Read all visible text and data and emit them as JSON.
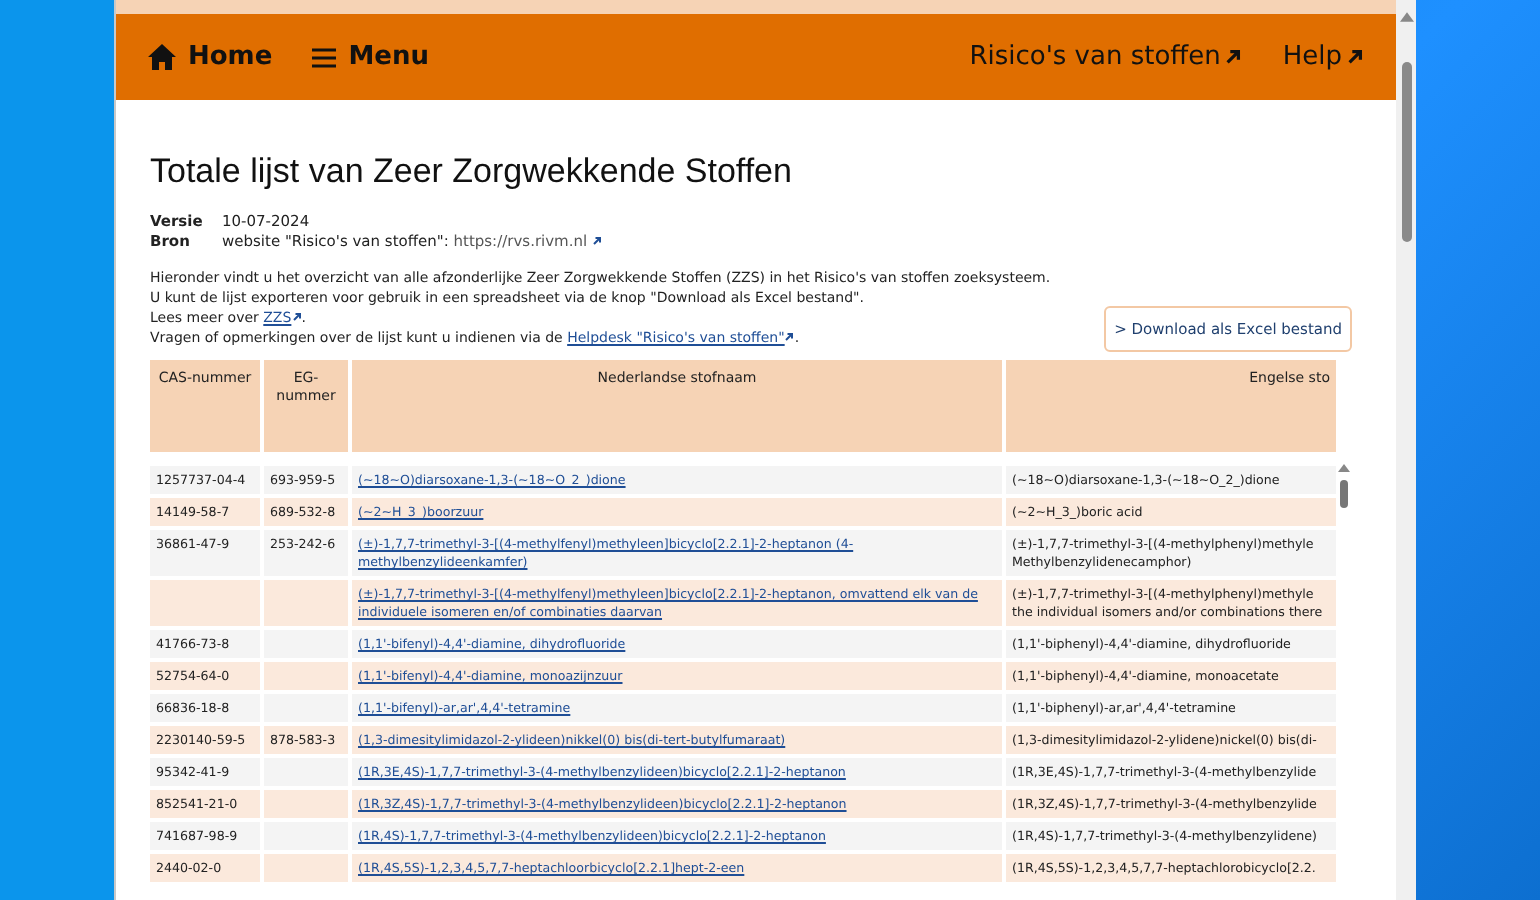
{
  "nav": {
    "home": "Home",
    "menu": "Menu",
    "links": [
      "Risico's van stoffen",
      "Help"
    ]
  },
  "page": {
    "title": "Totale lijst van Zeer Zorgwekkende Stoffen",
    "meta": [
      {
        "label": "Versie",
        "value": "10-07-2024"
      },
      {
        "label": "Bron",
        "value": "website \"Risico's van stoffen\": ",
        "link": "https://rvs.rivm.nl"
      }
    ],
    "intro": [
      "Hieronder vindt u het overzicht van alle afzonderlijke Zeer Zorgwekkende Stoffen (ZZS) in het Risico's van stoffen zoeksysteem.",
      "U kunt de lijst exporteren voor gebruik in een spreadsheet via de knop \"Download als Excel bestand\"."
    ],
    "more": {
      "text": "Lees meer over ",
      "link": "ZZS",
      "end": "."
    },
    "questions": {
      "text": "Vragen of opmerkingen over de lijst kunt u indienen via de ",
      "link": "Helpdesk \"Risico's van stoffen\"",
      "end": "."
    },
    "download_button": "> Download als Excel bestand"
  },
  "table": {
    "columns": [
      "CAS-nummer",
      "EG-nummer",
      "Nederlandse stofnaam",
      "Engelse sto"
    ],
    "rows": [
      {
        "cas": "1257737-04-4",
        "eg": "693-959-5",
        "nl": "(~18~O)diarsoxane-1,3-(~18~O_2_)dione",
        "en": "(~18~O)diarsoxane-1,3-(~18~O_2_)dione"
      },
      {
        "cas": "14149-58-7",
        "eg": "689-532-8",
        "nl": "(~2~H_3_)boorzuur",
        "en": "(~2~H_3_)boric acid"
      },
      {
        "cas": "36861-47-9",
        "eg": "253-242-6",
        "nl": "(±)-1,7,7-trimethyl-3-[(4-methylfenyl)methyleen]bicyclo[2.2.1]-2-heptanon (4-methylbenzylideenkamfer)",
        "en": "(±)-1,7,7-trimethyl-3-[(4-methylphenyl)methyle Methylbenzylidenecamphor)"
      },
      {
        "cas": "",
        "eg": "",
        "nl": "(±)-1,7,7-trimethyl-3-[(4-methylfenyl)methyleen]bicyclo[2.2.1]-2-heptanon, omvattend elk van de individuele isomeren en/of combinaties daarvan",
        "en": "(±)-1,7,7-trimethyl-3-[(4-methylphenyl)methyle the individual isomers and/or combinations there"
      },
      {
        "cas": "41766-73-8",
        "eg": "",
        "nl": "(1,1'-bifenyl)-4,4'-diamine, dihydrofluoride",
        "en": "(1,1'-biphenyl)-4,4'-diamine, dihydrofluoride"
      },
      {
        "cas": "52754-64-0",
        "eg": "",
        "nl": "(1,1'-bifenyl)-4,4'-diamine, monoazijnzuur",
        "en": "(1,1'-biphenyl)-4,4'-diamine, monoacetate"
      },
      {
        "cas": "66836-18-8",
        "eg": "",
        "nl": "(1,1'-bifenyl)-ar,ar',4,4'-tetramine",
        "en": "(1,1'-biphenyl)-ar,ar',4,4'-tetramine"
      },
      {
        "cas": "2230140-59-5",
        "eg": "878-583-3",
        "nl": "(1,3-dimesitylimidazol-2-ylideen)nikkel(0) bis(di-tert-butylfumaraat)",
        "en": "(1,3-dimesitylimidazol-2-ylidene)nickel(0) bis(di-"
      },
      {
        "cas": "95342-41-9",
        "eg": "",
        "nl": "(1R,3E,4S)-1,7,7-trimethyl-3-(4-methylbenzylideen)bicyclo[2.2.1]-2-heptanon",
        "en": "(1R,3E,4S)-1,7,7-trimethyl-3-(4-methylbenzylide"
      },
      {
        "cas": "852541-21-0",
        "eg": "",
        "nl": "(1R,3Z,4S)-1,7,7-trimethyl-3-(4-methylbenzylideen)bicyclo[2.2.1]-2-heptanon",
        "en": "(1R,3Z,4S)-1,7,7-trimethyl-3-(4-methylbenzylide"
      },
      {
        "cas": "741687-98-9",
        "eg": "",
        "nl": "(1R,4S)-1,7,7-trimethyl-3-(4-methylbenzylideen)bicyclo[2.2.1]-2-heptanon",
        "en": "(1R,4S)-1,7,7-trimethyl-3-(4-methylbenzylidene)"
      },
      {
        "cas": "2440-02-0",
        "eg": "",
        "nl": "(1R,4S,5S)-1,2,3,4,5,7,7-heptachloorbicyclo[2.2.1]hept-2-een",
        "en": "(1R,4S,5S)-1,2,3,4,5,7,7-heptachlorobicyclo[2.2."
      }
    ]
  }
}
